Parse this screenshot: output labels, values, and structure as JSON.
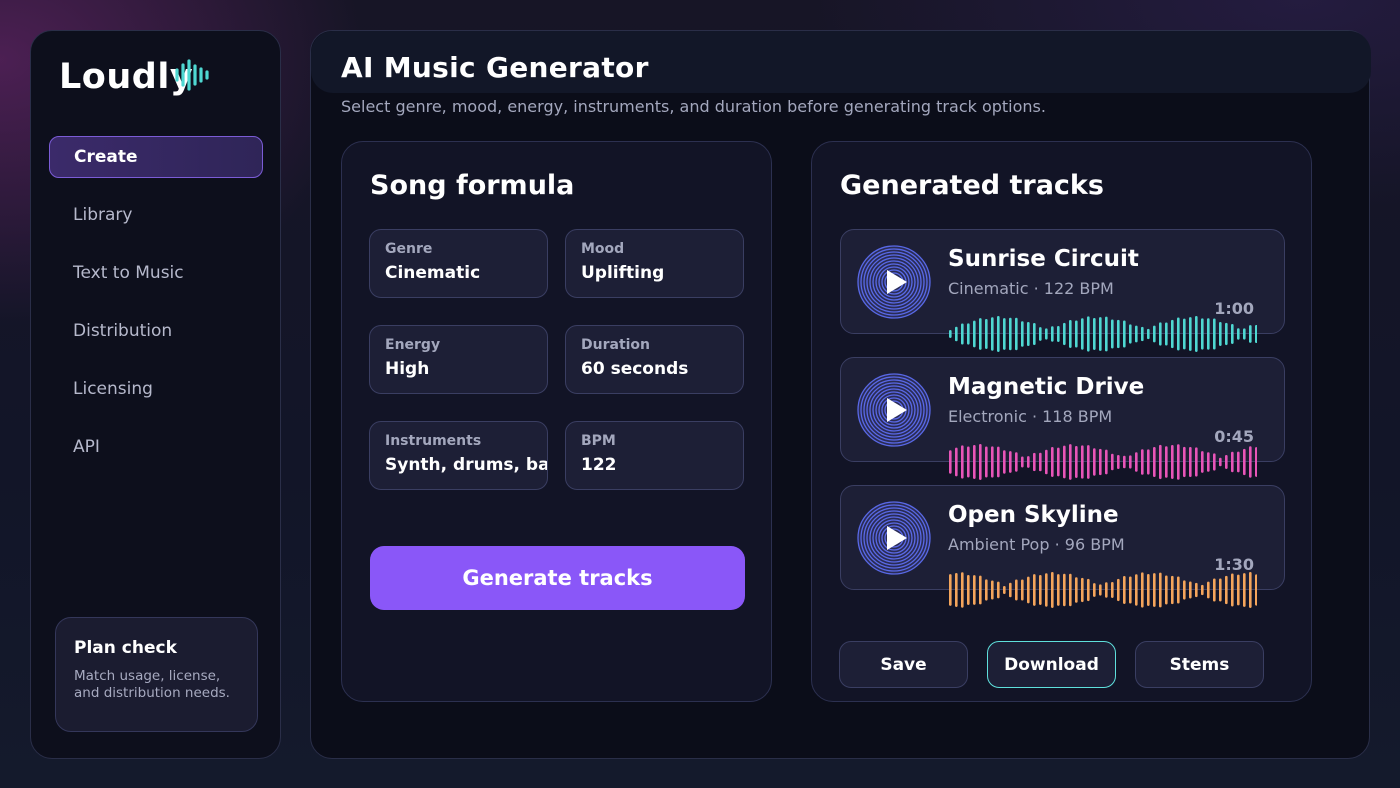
{
  "brand": {
    "name": "Loudly",
    "accent": "#4fd8d2"
  },
  "sidebar": {
    "items": [
      {
        "label": "Create",
        "active": true
      },
      {
        "label": "Library"
      },
      {
        "label": "Text to Music"
      },
      {
        "label": "Distribution"
      },
      {
        "label": "Licensing"
      },
      {
        "label": "API"
      }
    ],
    "plan": {
      "title": "Plan check",
      "description": "Match usage, license, and distribution needs."
    }
  },
  "header": {
    "title": "AI Music Generator",
    "subtitle": "Select genre, mood, energy, instruments, and duration before generating track options."
  },
  "formula": {
    "title": "Song formula",
    "fields": [
      {
        "label": "Genre",
        "value": "Cinematic"
      },
      {
        "label": "Mood",
        "value": "Uplifting"
      },
      {
        "label": "Energy",
        "value": "High"
      },
      {
        "label": "Duration",
        "value": "60 seconds"
      },
      {
        "label": "Instruments",
        "value": "Synth, drums, bass"
      },
      {
        "label": "BPM",
        "value": "122"
      }
    ],
    "generate_label": "Generate tracks",
    "button_color": "#8a57f8"
  },
  "tracks": {
    "title": "Generated tracks",
    "items": [
      {
        "title": "Sunrise Circuit",
        "meta": "Cinematic · 122 BPM",
        "duration": "1:00",
        "color": "#4fd8d2"
      },
      {
        "title": "Magnetic Drive",
        "meta": "Electronic · 118 BPM",
        "duration": "0:45",
        "color": "#e855b8"
      },
      {
        "title": "Open Skyline",
        "meta": "Ambient Pop · 96 BPM",
        "duration": "1:30",
        "color": "#f4a55c"
      }
    ],
    "actions": {
      "save": "Save",
      "download": "Download",
      "stems": "Stems"
    }
  }
}
